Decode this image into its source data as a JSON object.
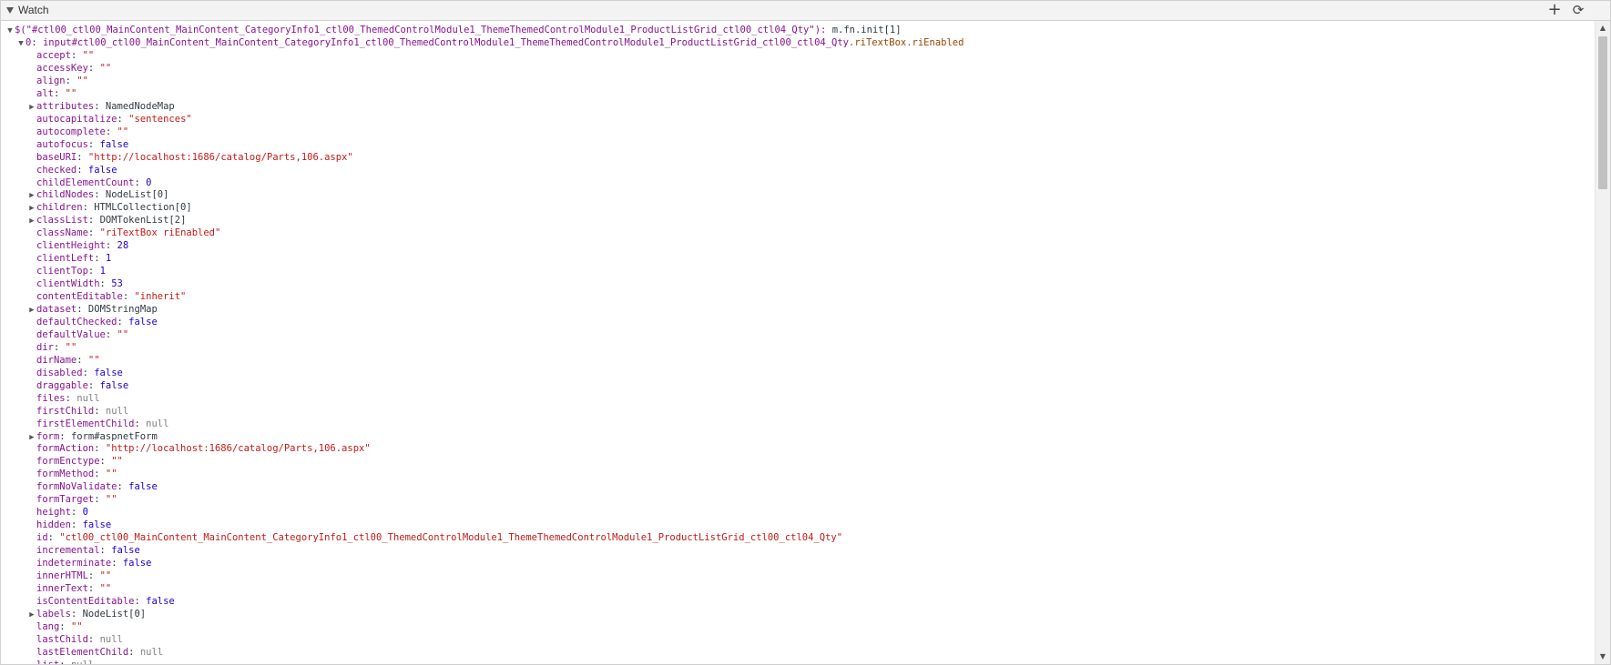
{
  "panel": {
    "title": "Watch",
    "add_icon": "+",
    "refresh_icon": "⟳"
  },
  "scroll_icons": {
    "up": "▲",
    "down": "▼"
  },
  "root_expr": {
    "prefix": "$(\"",
    "selector": "#ctl00_ctl00_MainContent_MainContent_CategoryInfo1_ctl00_ThemedControlModule1_ThemeThemedControlModule1_ProductListGrid_ctl00_ctl04_Qty",
    "suffix": "\"): ",
    "value": "m.fn.init[1]"
  },
  "item0": {
    "key": "0",
    "tag": "input#ctl00_ctl00_MainContent_MainContent_CategoryInfo1_ctl00_ThemedControlModule1_ThemeThemedControlModule1_ProductListGrid_ctl00_ctl04_Qty",
    "cls": ".riTextBox.riEnabled"
  },
  "properties": [
    {
      "key": "accept",
      "value": "\"\"",
      "type": "str",
      "expandable": false
    },
    {
      "key": "accessKey",
      "value": "\"\"",
      "type": "str",
      "expandable": false
    },
    {
      "key": "align",
      "value": "\"\"",
      "type": "str",
      "expandable": false
    },
    {
      "key": "alt",
      "value": "\"\"",
      "type": "str",
      "expandable": false
    },
    {
      "key": "attributes",
      "value": "NamedNodeMap",
      "type": "obj",
      "expandable": true
    },
    {
      "key": "autocapitalize",
      "value": "\"sentences\"",
      "type": "str",
      "expandable": false
    },
    {
      "key": "autocomplete",
      "value": "\"\"",
      "type": "str",
      "expandable": false
    },
    {
      "key": "autofocus",
      "value": "false",
      "type": "bool",
      "expandable": false
    },
    {
      "key": "baseURI",
      "value": "\"http://localhost:1686/catalog/Parts,106.aspx\"",
      "type": "str",
      "expandable": false
    },
    {
      "key": "checked",
      "value": "false",
      "type": "bool",
      "expandable": false
    },
    {
      "key": "childElementCount",
      "value": "0",
      "type": "num",
      "expandable": false
    },
    {
      "key": "childNodes",
      "value": "NodeList[0]",
      "type": "obj",
      "expandable": true
    },
    {
      "key": "children",
      "value": "HTMLCollection[0]",
      "type": "obj",
      "expandable": true
    },
    {
      "key": "classList",
      "value": "DOMTokenList[2]",
      "type": "obj",
      "expandable": true
    },
    {
      "key": "className",
      "value": "\"riTextBox riEnabled\"",
      "type": "str",
      "expandable": false
    },
    {
      "key": "clientHeight",
      "value": "28",
      "type": "num",
      "expandable": false
    },
    {
      "key": "clientLeft",
      "value": "1",
      "type": "num",
      "expandable": false
    },
    {
      "key": "clientTop",
      "value": "1",
      "type": "num",
      "expandable": false
    },
    {
      "key": "clientWidth",
      "value": "53",
      "type": "num",
      "expandable": false
    },
    {
      "key": "contentEditable",
      "value": "\"inherit\"",
      "type": "str",
      "expandable": false
    },
    {
      "key": "dataset",
      "value": "DOMStringMap",
      "type": "obj",
      "expandable": true
    },
    {
      "key": "defaultChecked",
      "value": "false",
      "type": "bool",
      "expandable": false
    },
    {
      "key": "defaultValue",
      "value": "\"\"",
      "type": "str",
      "expandable": false
    },
    {
      "key": "dir",
      "value": "\"\"",
      "type": "str",
      "expandable": false
    },
    {
      "key": "dirName",
      "value": "\"\"",
      "type": "str",
      "expandable": false
    },
    {
      "key": "disabled",
      "value": "false",
      "type": "bool",
      "expandable": false
    },
    {
      "key": "draggable",
      "value": "false",
      "type": "bool",
      "expandable": false
    },
    {
      "key": "files",
      "value": "null",
      "type": "nul",
      "expandable": false
    },
    {
      "key": "firstChild",
      "value": "null",
      "type": "nul",
      "expandable": false
    },
    {
      "key": "firstElementChild",
      "value": "null",
      "type": "nul",
      "expandable": false
    },
    {
      "key": "form",
      "value": "form#aspnetForm",
      "type": "obj",
      "expandable": true
    },
    {
      "key": "formAction",
      "value": "\"http://localhost:1686/catalog/Parts,106.aspx\"",
      "type": "str",
      "expandable": false
    },
    {
      "key": "formEnctype",
      "value": "\"\"",
      "type": "str",
      "expandable": false
    },
    {
      "key": "formMethod",
      "value": "\"\"",
      "type": "str",
      "expandable": false
    },
    {
      "key": "formNoValidate",
      "value": "false",
      "type": "bool",
      "expandable": false
    },
    {
      "key": "formTarget",
      "value": "\"\"",
      "type": "str",
      "expandable": false
    },
    {
      "key": "height",
      "value": "0",
      "type": "num",
      "expandable": false
    },
    {
      "key": "hidden",
      "value": "false",
      "type": "bool",
      "expandable": false
    },
    {
      "key": "id",
      "value": "\"ctl00_ctl00_MainContent_MainContent_CategoryInfo1_ctl00_ThemedControlModule1_ThemeThemedControlModule1_ProductListGrid_ctl00_ctl04_Qty\"",
      "type": "str",
      "expandable": false
    },
    {
      "key": "incremental",
      "value": "false",
      "type": "bool",
      "expandable": false
    },
    {
      "key": "indeterminate",
      "value": "false",
      "type": "bool",
      "expandable": false
    },
    {
      "key": "innerHTML",
      "value": "\"\"",
      "type": "str",
      "expandable": false
    },
    {
      "key": "innerText",
      "value": "\"\"",
      "type": "str",
      "expandable": false
    },
    {
      "key": "isContentEditable",
      "value": "false",
      "type": "bool",
      "expandable": false
    },
    {
      "key": "labels",
      "value": "NodeList[0]",
      "type": "obj",
      "expandable": true
    },
    {
      "key": "lang",
      "value": "\"\"",
      "type": "str",
      "expandable": false
    },
    {
      "key": "lastChild",
      "value": "null",
      "type": "nul",
      "expandable": false
    },
    {
      "key": "lastElementChild",
      "value": "null",
      "type": "nul",
      "expandable": false
    },
    {
      "key": "list",
      "value": "null",
      "type": "nul",
      "expandable": false
    }
  ]
}
